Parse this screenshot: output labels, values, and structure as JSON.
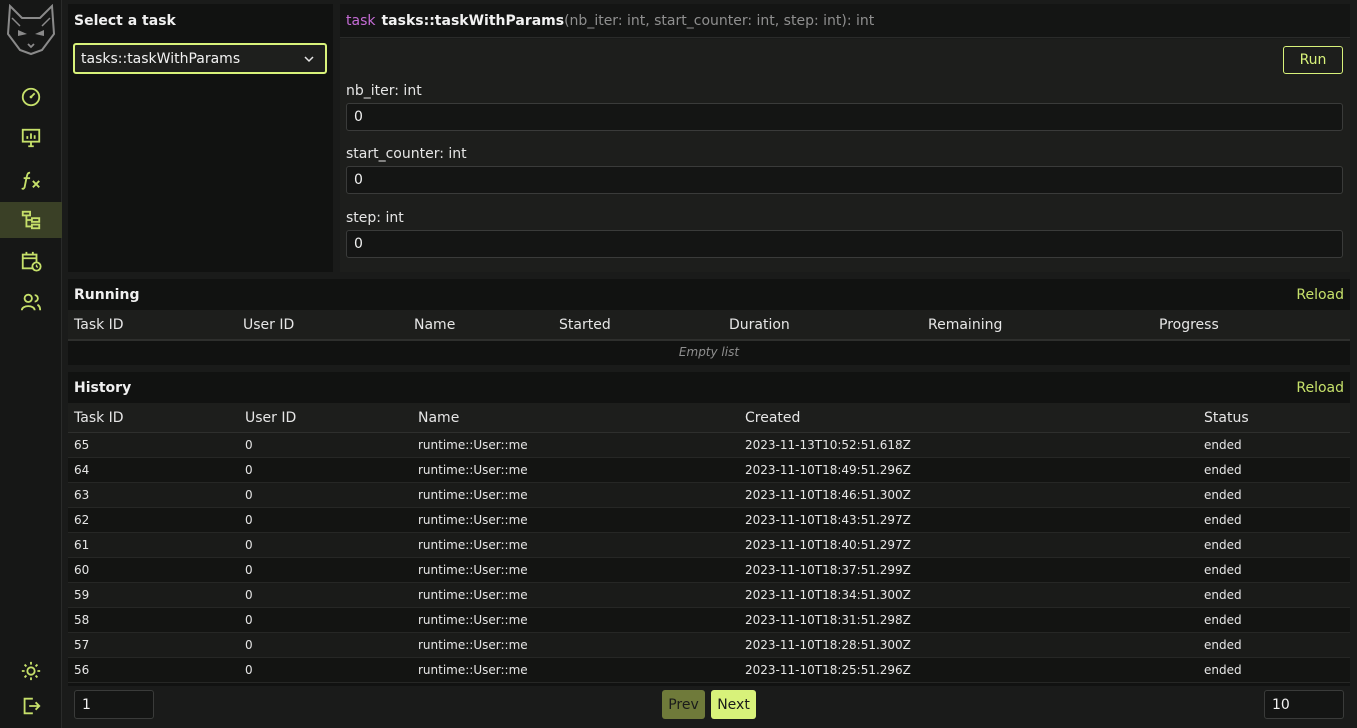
{
  "sidebar": {
    "logo": "cat-logo",
    "items": [
      {
        "icon": "gauge-icon",
        "active": false
      },
      {
        "icon": "monitor-chart-icon",
        "active": false
      },
      {
        "icon": "function-icon",
        "active": false
      },
      {
        "icon": "task-tree-icon",
        "active": true
      },
      {
        "icon": "calendar-clock-icon",
        "active": false
      },
      {
        "icon": "users-icon",
        "active": false
      }
    ],
    "bottom": [
      {
        "icon": "sun-icon"
      },
      {
        "icon": "logout-icon"
      }
    ]
  },
  "task_select": {
    "title": "Select a task",
    "selected": "tasks::taskWithParams"
  },
  "task_detail": {
    "keyword": "task",
    "name": "tasks::taskWithParams",
    "signature": "(nb_iter: int, start_counter: int, step: int): int",
    "run_label": "Run",
    "fields": [
      {
        "label": "nb_iter: int",
        "value": "0"
      },
      {
        "label": "start_counter: int",
        "value": "0"
      },
      {
        "label": "step: int",
        "value": "0"
      }
    ]
  },
  "running": {
    "title": "Running",
    "reload": "Reload",
    "columns": [
      "Task ID",
      "User ID",
      "Name",
      "Started",
      "Duration",
      "Remaining",
      "Progress"
    ],
    "empty": "Empty list"
  },
  "history": {
    "title": "History",
    "reload": "Reload",
    "columns": [
      "Task ID",
      "User ID",
      "Name",
      "Created",
      "Status"
    ],
    "rows": [
      [
        "65",
        "0",
        "runtime::User::me",
        "2023-11-13T10:52:51.618Z",
        "ended"
      ],
      [
        "64",
        "0",
        "runtime::User::me",
        "2023-11-10T18:49:51.296Z",
        "ended"
      ],
      [
        "63",
        "0",
        "runtime::User::me",
        "2023-11-10T18:46:51.300Z",
        "ended"
      ],
      [
        "62",
        "0",
        "runtime::User::me",
        "2023-11-10T18:43:51.297Z",
        "ended"
      ],
      [
        "61",
        "0",
        "runtime::User::me",
        "2023-11-10T18:40:51.297Z",
        "ended"
      ],
      [
        "60",
        "0",
        "runtime::User::me",
        "2023-11-10T18:37:51.299Z",
        "ended"
      ],
      [
        "59",
        "0",
        "runtime::User::me",
        "2023-11-10T18:34:51.300Z",
        "ended"
      ],
      [
        "58",
        "0",
        "runtime::User::me",
        "2023-11-10T18:31:51.298Z",
        "ended"
      ],
      [
        "57",
        "0",
        "runtime::User::me",
        "2023-11-10T18:28:51.300Z",
        "ended"
      ],
      [
        "56",
        "0",
        "runtime::User::me",
        "2023-11-10T18:25:51.296Z",
        "ended"
      ]
    ]
  },
  "pagination": {
    "page": "1",
    "prev": "Prev",
    "next": "Next",
    "page_size": "10"
  },
  "colors": {
    "accent": "#d8f27a",
    "keyword": "#c56cd6"
  }
}
